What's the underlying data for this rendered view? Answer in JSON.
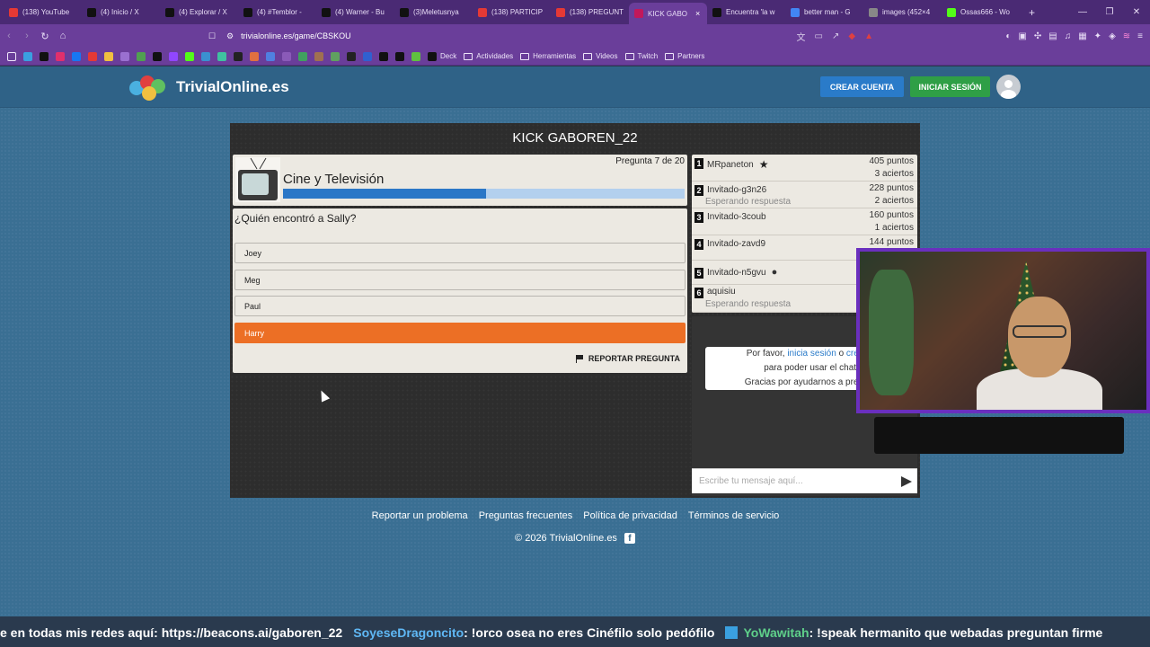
{
  "browser": {
    "tabs": [
      {
        "label": "(138) YouTube",
        "color": "#e53935"
      },
      {
        "label": "(4) Inicio / X",
        "color": "#111111"
      },
      {
        "label": "(4) Explorar / X",
        "color": "#111111"
      },
      {
        "label": "(4) #Temblor -",
        "color": "#111111"
      },
      {
        "label": "(4) Warner - Bu",
        "color": "#111111"
      },
      {
        "label": "(3)Meletusnya",
        "color": "#111111"
      },
      {
        "label": "(138) PARTICIP",
        "color": "#e53935"
      },
      {
        "label": "(138) PREGUNT",
        "color": "#e53935"
      },
      {
        "label": "KICK GABO",
        "color": "#c2185b",
        "active": true
      },
      {
        "label": "Encuentra 'la w",
        "color": "#111111"
      },
      {
        "label": "better man - G",
        "color": "#4285f4"
      },
      {
        "label": "images (452×4",
        "color": "#888888"
      },
      {
        "label": "Ossas666 - Wo",
        "color": "#53fc18"
      }
    ],
    "url": "trivialonline.es/game/CBSKOU",
    "bookmarks": [
      "Deck",
      "Actividades",
      "Herramientas",
      "Videos",
      "Twitch",
      "Partners"
    ]
  },
  "site": {
    "name": "TrivialOnline.es",
    "create_account": "CREAR CUENTA",
    "login": "INICIAR SESIÓN"
  },
  "game": {
    "room_title": "KICK GABOREN_22",
    "category": "Cine y Televisión",
    "question_counter": "Pregunta 7 de 20",
    "progress_fraction": 0.505,
    "question": "¿Quién encontró a Sally?",
    "options": [
      "Joey",
      "Meg",
      "Paul",
      "Harry"
    ],
    "selected_option": "Harry",
    "report_label": "REPORTAR PREGUNTA"
  },
  "players": [
    {
      "rank": "1",
      "name": "MRpaneton",
      "points": "405 puntos",
      "hits": "3 aciertos",
      "status": ""
    },
    {
      "rank": "2",
      "name": "Invitado-g3n26",
      "points": "228 puntos",
      "hits": "2 aciertos",
      "status": "Esperando respuesta"
    },
    {
      "rank": "3",
      "name": "Invitado-3coub",
      "points": "160 puntos",
      "hits": "1 aciertos",
      "status": ""
    },
    {
      "rank": "4",
      "name": "Invitado-zavd9",
      "points": "144 puntos",
      "hits": "",
      "status": ""
    },
    {
      "rank": "5",
      "name": "Invitado-n5gvu",
      "points": "",
      "hits": "",
      "status": ""
    },
    {
      "rank": "6",
      "name": "aquisiu",
      "points": "",
      "hits": "",
      "status": "Esperando respuesta"
    }
  ],
  "chat": {
    "line1_prefix": "Por favor,",
    "login_link": "inicia sesión",
    "or": "o",
    "create_link": "crea un",
    "line2": "para poder usar el chat.",
    "line3": "Gracias por ayudarnos a prevenir",
    "input_placeholder": "Escribe tu mensaje aquí..."
  },
  "footer": {
    "links": [
      "Reportar un problema",
      "Preguntas frecuentes",
      "Política de privacidad",
      "Términos de servicio"
    ],
    "copyright": "© 2026 TrivialOnline.es"
  },
  "ticker": {
    "text1": "e en todas mis redes aquí: https://beacons.ai/gaboren_22",
    "user1": "SoyeseDragoncito",
    "msg1": ": !orco osea no eres Cinéfilo solo pedófilo",
    "user2": "YoWawitah",
    "msg2": ": !speak hermanito que webadas preguntan firme"
  }
}
